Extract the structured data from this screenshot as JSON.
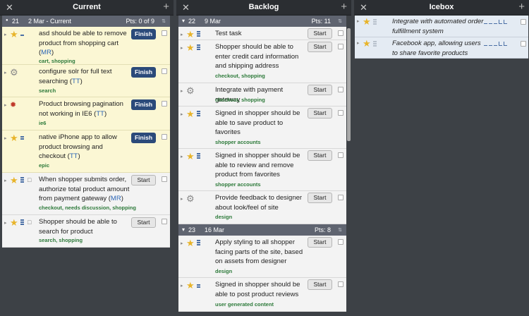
{
  "panels": {
    "current": {
      "title": "Current",
      "iteration": {
        "number": "21",
        "date": "2 Mar - Current",
        "points": "Pts: 0 of 9"
      },
      "stories": [
        {
          "text": "asd should be able to remove product from shopping cart",
          "link": "MR",
          "labels": "cart, shopping",
          "button": "Finish"
        },
        {
          "text": "configure solr for full text searching",
          "link": "TT",
          "labels": "search",
          "button": "Finish"
        },
        {
          "text": "Product browsing pagination not working in IE6",
          "link": "TT",
          "labels": "ie6",
          "button": "Finish"
        },
        {
          "text": "native iPhone app to allow product browsing and checkout",
          "link": "TT",
          "labels": "epic",
          "button": "Finish"
        },
        {
          "text": "When shopper submits order, authorize total product amount from payment gateway",
          "link": "MR",
          "labels": "checkout, needs discussion, shopping",
          "button": "Start"
        },
        {
          "text": "Shopper should be able to search for product",
          "labels": "search, shopping",
          "button": "Start"
        }
      ]
    },
    "backlog": {
      "title": "Backlog",
      "iteration1": {
        "number": "22",
        "date": "9 Mar",
        "points": "Pts: 11"
      },
      "iteration2": {
        "number": "23",
        "date": "16 Mar",
        "points": "Pts: 8"
      },
      "stories": [
        {
          "text": "Test task",
          "button": "Start"
        },
        {
          "text": "Shopper should be able to enter credit card information and shipping address",
          "labels": "checkout, shopping",
          "button": "Start"
        },
        {
          "text": "Integrate with payment gateway",
          "labels": "checkout, shopping",
          "button": "Start"
        },
        {
          "text": "Signed in shopper should be able to save product to favorites",
          "labels": "shopper accounts",
          "button": "Start"
        },
        {
          "text": "Signed in shopper should be able to review and remove product from favorites",
          "labels": "shopper accounts",
          "button": "Start"
        },
        {
          "text": "Provide feedback to designer about look/feel of site",
          "labels": "design",
          "button": "Start"
        },
        {
          "text": "Apply styling to all shopper facing parts of the site, based on assets from designer",
          "labels": "design",
          "button": "Start"
        },
        {
          "text": "Signed in shopper should be able to post product reviews",
          "labels": "user generated content",
          "button": "Start"
        }
      ]
    },
    "icebox": {
      "title": "Icebox",
      "stories": [
        {
          "text": "Integrate with automated order fulfillment system"
        },
        {
          "text": "Facebook app, allowing users to share favorite products"
        }
      ]
    }
  },
  "icons": {
    "close": "✕",
    "add": "+",
    "star": "★",
    "gear": "⚙",
    "bug": "🐞",
    "comment": "□",
    "sort": "⇅",
    "expand": "▸",
    "collapse": "▾",
    "dot": "●"
  },
  "colors": {
    "header_bg": "#2b2e32",
    "iteration_bg": "#5f6470",
    "started_bg": "#fbf7d4",
    "unstarted_bg": "#f3f3f3",
    "icebox_bg": "#e4ebf3",
    "finish_button": "#2b4a7a",
    "label_green": "#2d7a3a",
    "link_blue": "#2a64b5",
    "star": "#e8b42a"
  }
}
